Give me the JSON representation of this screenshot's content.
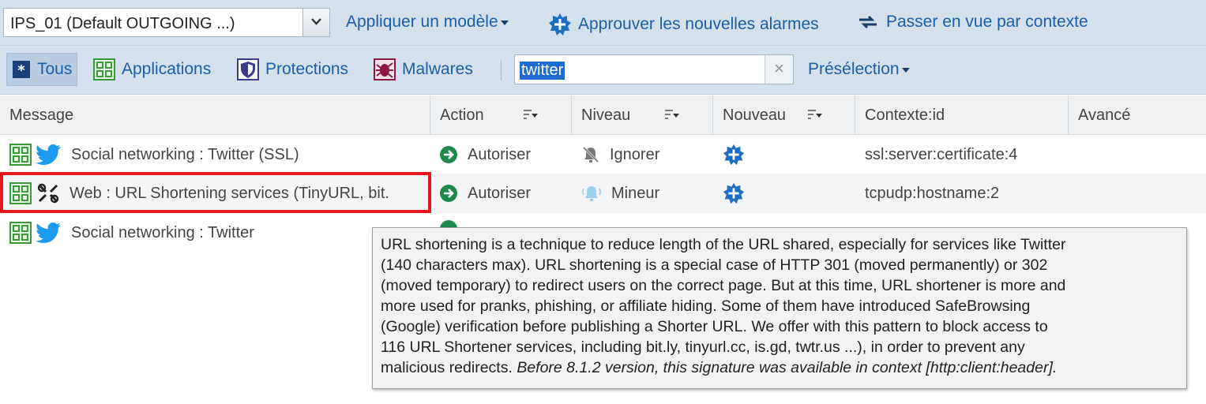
{
  "toolbar": {
    "policy_value": "IPS_01 (Default OUTGOING ...)",
    "apply_template": "Appliquer un modèle",
    "approve_alarms": "Approuver les nouvelles alarmes",
    "context_view": "Passer en vue par contexte"
  },
  "filters": {
    "all": "Tous",
    "applications": "Applications",
    "protections": "Protections",
    "malwares": "Malwares",
    "search_value": "twitter",
    "preselection": "Présélection"
  },
  "table": {
    "headers": [
      "Message",
      "Action",
      "Niveau",
      "Nouveau",
      "Contexte:id",
      "Avancé"
    ],
    "rows": [
      {
        "message": "Social networking : Twitter (SSL)",
        "action": "Autoriser",
        "level": "Ignorer",
        "context": "ssl:server:certificate:4"
      },
      {
        "message": "Web : URL Shortening services (TinyURL, bit.",
        "action": "Autoriser",
        "level": "Mineur",
        "context": "tcpudp:hostname:2"
      },
      {
        "message": "Social networking : Twitter",
        "action": "",
        "level": "",
        "context": ""
      }
    ]
  },
  "tooltip": {
    "line1": "URL shortening is a technique to reduce length of the URL shared, especially for services like Twitter",
    "line2": "(140 characters max). URL shortening is a special case of HTTP 301 (moved permanently) or 302",
    "line3": "(moved temporary) to redirect users on the correct page. But at this time, URL shortener is more and",
    "line4": "more used for pranks, phishing, or affiliate hiding. Some of them have introduced SafeBrowsing",
    "line5": "(Google) verification before publishing a Shorter URL. We offer with this pattern to block access to",
    "line6": "116 URL Shortener services, including bit.ly, tinyurl.cc, is.gd, twtr.us ...), in order to prevent any",
    "line7": "malicious redirects.",
    "line7_italic": "Before 8.1.2 version, this signature was available in context [http:client:header]."
  },
  "colors": {
    "link": "#1a5fa8",
    "toolbar_bg": "#d4e0ec",
    "highlight_border": "#e4181e",
    "allow_green": "#1e8a4a",
    "new_badge": "#1d6fc2"
  }
}
